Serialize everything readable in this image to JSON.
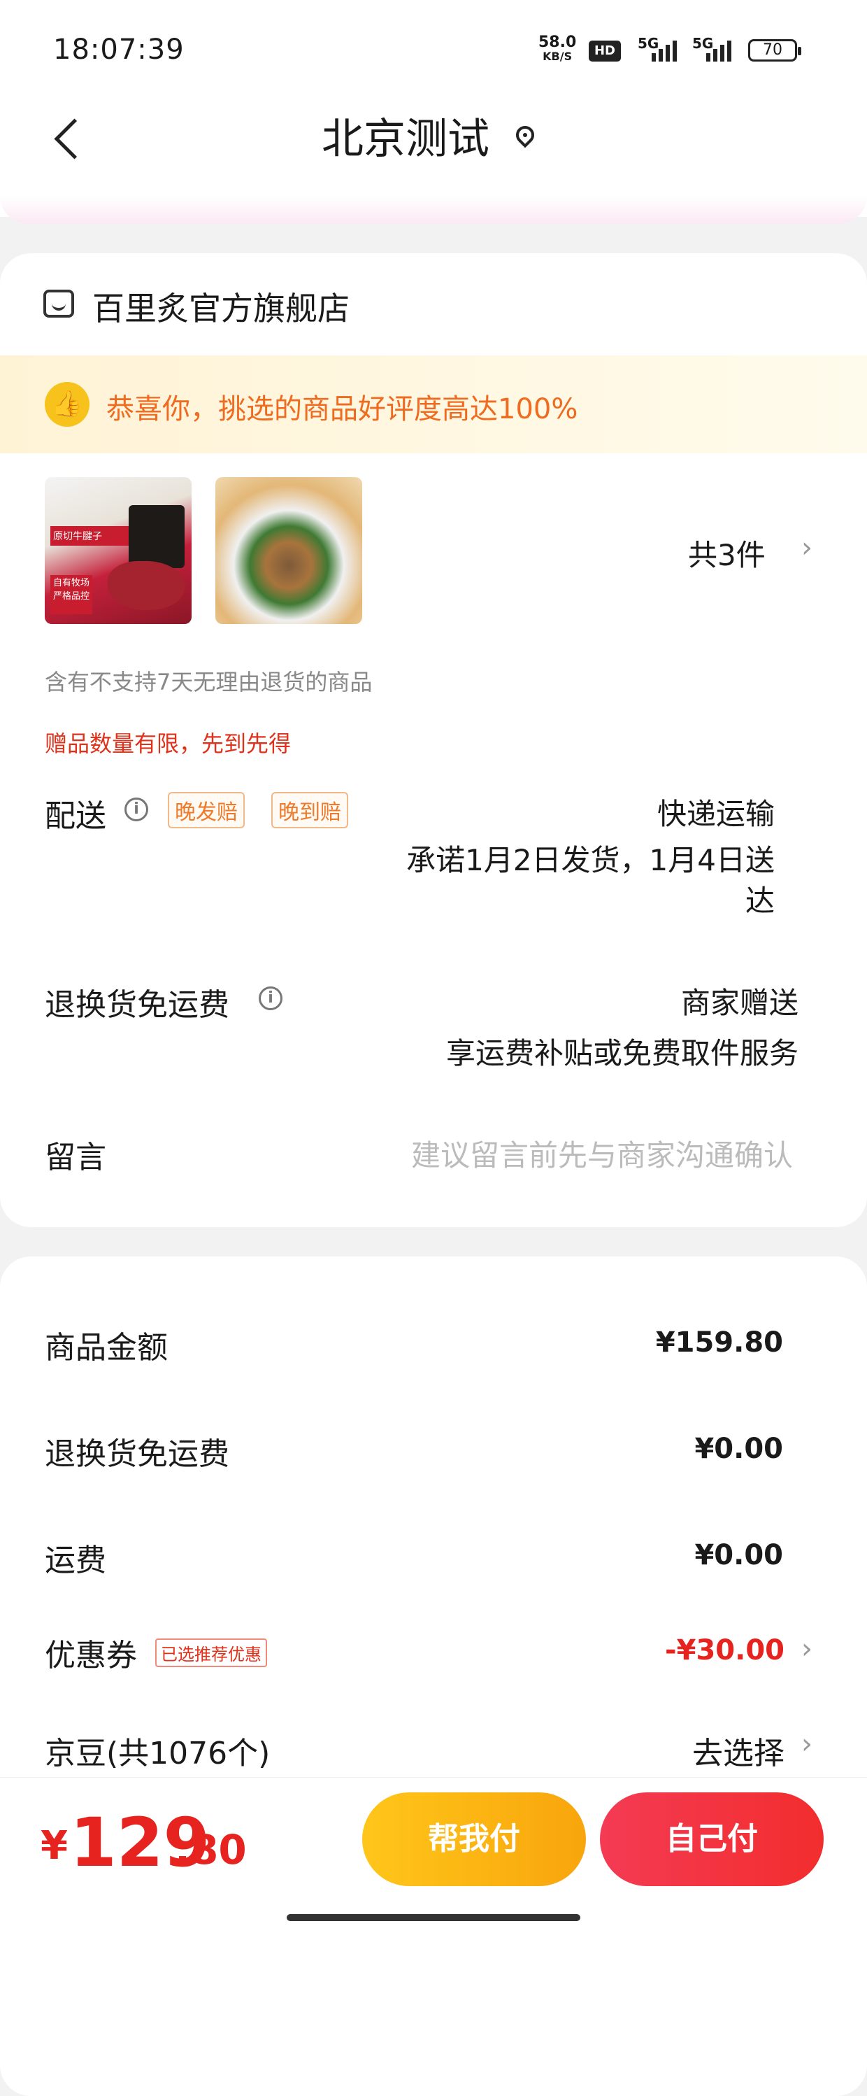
{
  "status_bar": {
    "time": "18:07:39",
    "net_speed": "58.0",
    "net_unit": "KB/S",
    "hd": "HD",
    "sig1": "5G",
    "sig2": "5G",
    "battery": "70"
  },
  "nav": {
    "title": "北京测试",
    "back_icon": "chevron-left-icon",
    "location_icon": "location-pin-icon"
  },
  "shop": {
    "name": "百里炙官方旗舰店",
    "praise_text": "恭喜你，挑选的商品好评度高达100%",
    "products": [
      {
        "label": "原切牛腱子",
        "badge": "自有牧场 严格品控"
      },
      {
        "label": ""
      }
    ],
    "count_text": "共3件",
    "no_return_note": "含有不支持7天无理由退货的商品",
    "gift_note": "赠品数量有限，先到先得",
    "delivery": {
      "label": "配送",
      "tag1": "晚发赔",
      "tag2": "晚到赔",
      "method": "快递运输",
      "promise": "承诺1月2日发货，1月4日送",
      "promise_tail": "达"
    },
    "return_shipping": {
      "label": "退换货免运费",
      "value": "商家赠送",
      "desc": "享运费补贴或免费取件服务"
    },
    "message": {
      "label": "留言",
      "placeholder": "建议留言前先与商家沟通确认"
    }
  },
  "payment": {
    "rows": [
      {
        "label": "商品金额",
        "value": "¥159.80"
      },
      {
        "label": "退换货免运费",
        "value": "¥0.00"
      },
      {
        "label": "运费",
        "value": "¥0.00"
      },
      {
        "label": "优惠券",
        "tag": "已选推荐优惠",
        "value": "-¥30.00"
      },
      {
        "label": "京豆(共1076个)",
        "value": "去选择"
      }
    ]
  },
  "bottom": {
    "currency": "¥",
    "amount_int": "129",
    "amount_dec": ".80",
    "help_pay": "帮我付",
    "self_pay": "自己付"
  },
  "colors": {
    "accent_red": "#e6231e",
    "accent_orange": "#ee6b1f",
    "help_btn": "#f8a50c",
    "self_btn": "#f22d2d"
  }
}
